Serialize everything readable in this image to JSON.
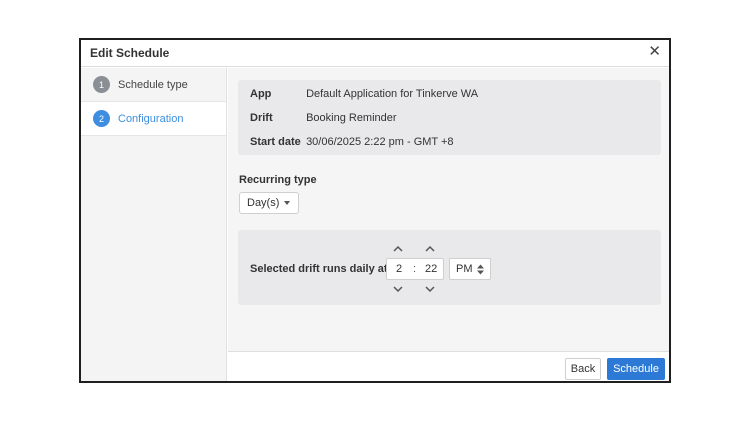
{
  "dialog": {
    "title": "Edit Schedule",
    "close_glyph": "✕"
  },
  "steps": [
    {
      "number": "1",
      "label": "Schedule type"
    },
    {
      "number": "2",
      "label": "Configuration"
    }
  ],
  "info": {
    "app_key": "App",
    "app_value": "Default Application for Tinkerve WA",
    "drift_key": "Drift",
    "drift_value": "Booking Reminder",
    "start_key": "Start date",
    "start_value": "30/06/2025 2:22 pm - GMT +8"
  },
  "recurring": {
    "label": "Recurring type",
    "selected": "Day(s)"
  },
  "runs": {
    "label": "Selected drift runs daily at",
    "hour": "2",
    "separator": ":",
    "minute": "22",
    "ampm": "PM"
  },
  "footer": {
    "back_label": "Back",
    "schedule_label": "Schedule"
  },
  "colors": {
    "accent": "#3d8ee0",
    "primary_button": "#2d7ad6"
  }
}
